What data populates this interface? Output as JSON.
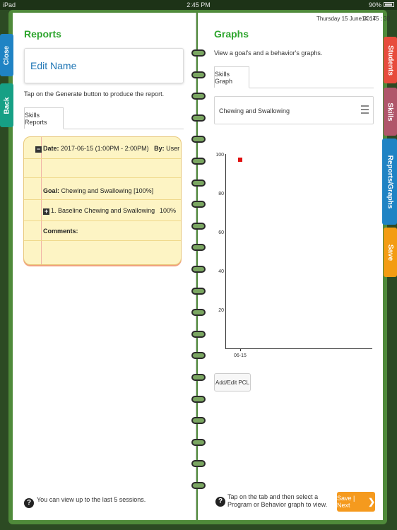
{
  "status_bar": {
    "device": "iPad",
    "time": "2:45 PM",
    "battery": "90%"
  },
  "datetime": {
    "date": "Thursday 15 June 2017",
    "clock": "14 : 45 : 30"
  },
  "left_tabs": [
    {
      "label": "Close",
      "color": "#1f83c4"
    },
    {
      "label": "Back",
      "color": "#16a085"
    }
  ],
  "right_tabs": [
    {
      "label": "Students",
      "color": "#e74c3c"
    },
    {
      "label": "Skills",
      "color": "#b0566a"
    },
    {
      "label": "Reports/Graphs",
      "color": "#1f83c4"
    },
    {
      "label": "Save",
      "color": "#f39c12"
    }
  ],
  "reports": {
    "title": "Reports",
    "edit_name": "Edit Name",
    "instruction": "Tap on the Generate button to produce the report.",
    "tab": "Skills Reports",
    "entry": {
      "date_label": "Date:",
      "date_value": "2017-06-15 (1:00PM - 2:00PM)",
      "by_label": "By:",
      "by_value": "User Single",
      "goal_label": "Goal:",
      "goal_value": "Chewing and Swallowing [100%]",
      "item_label": "1. Baseline Chewing and Swallowing",
      "item_value": "100%",
      "comments_label": "Comments:"
    },
    "footer_help": "You can view up to the last 5 sessions."
  },
  "graphs": {
    "title": "Graphs",
    "subtitle": "View a goal's and a behavior's graphs.",
    "tab": "Skills Graph",
    "selected": "Chewing and Swallowing",
    "add_edit_pcl": "Add/Edit PCL",
    "footer_help": "Tap on the tab and then select a Program or Behavior graph to view.",
    "next_button": "Save | Next"
  },
  "chart_data": {
    "type": "scatter",
    "categories": [
      "06-15"
    ],
    "series": [
      {
        "values": [
          97
        ],
        "color": "#e01010"
      }
    ],
    "y_ticks": [
      "100",
      "80",
      "60",
      "40",
      "20"
    ],
    "ylim": [
      0,
      100
    ],
    "grid": false,
    "title": "",
    "xlabel": "",
    "ylabel": ""
  }
}
